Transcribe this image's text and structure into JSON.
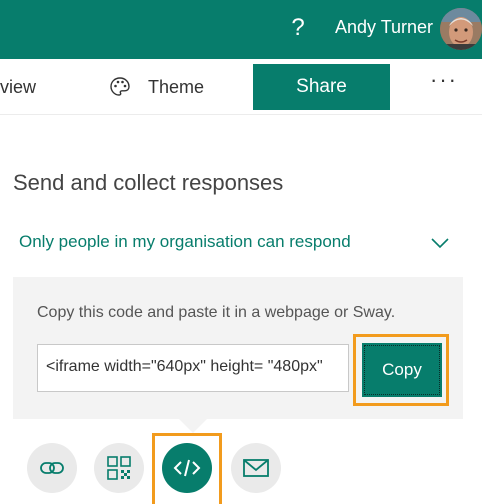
{
  "topbar": {
    "help_label": "?",
    "user_name": "Andy Turner",
    "colors": {
      "accent": "#077d6c",
      "highlight": "#f29b1d"
    }
  },
  "toolbar": {
    "preview_label": "view",
    "theme_label": "Theme",
    "share_label": "Share",
    "more_label": "···",
    "theme_icon": "palette-icon"
  },
  "share_panel": {
    "title": "Send and collect responses",
    "audience": "Only people in my organisation can respond",
    "instruction": "Copy this code and paste it in a webpage or Sway.",
    "embed_code": "<iframe width=\"640px\" height= \"480px\"",
    "copy_label": "Copy"
  },
  "share_methods": [
    {
      "icon": "link-icon",
      "active": false
    },
    {
      "icon": "qr-code-icon",
      "active": false
    },
    {
      "icon": "embed-code-icon",
      "active": true
    },
    {
      "icon": "mail-icon",
      "active": false
    }
  ]
}
